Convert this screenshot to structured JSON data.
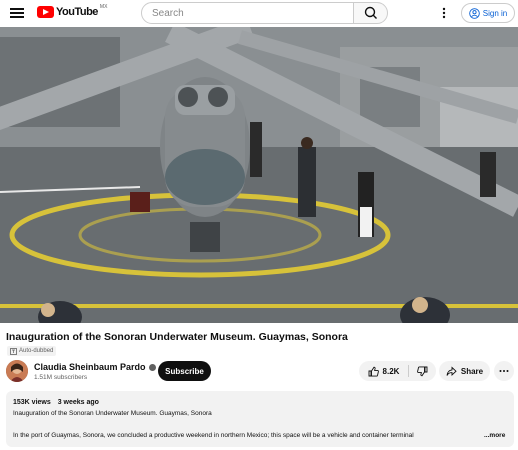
{
  "header": {
    "logo_text": "YouTube",
    "logo_region": "MX",
    "search_placeholder": "Search",
    "signin_label": "Sign in"
  },
  "video": {
    "title": "Inauguration of the Sonoran Underwater Museum. Guaymas, Sonora",
    "auto_dubbed_label": "Auto-dubbed"
  },
  "channel": {
    "name": "Claudia Sheinbaum Pardo",
    "subscribers": "1.51M subscribers",
    "subscribe_label": "Subscribe"
  },
  "actions": {
    "likes": "8.2K",
    "share_label": "Share"
  },
  "description": {
    "views": "153K views",
    "age": "3 weeks ago",
    "line1": "Inauguration of the Sonoran Underwater Museum. Guaymas, Sonora",
    "line2": "In the port of Guaymas, Sonora, we concluded a productive weekend in northern Mexico; this space will be a vehicle and container terminal",
    "more_label": "...more"
  },
  "colors": {
    "brand_red": "#ff0000",
    "link_blue": "#065fd4",
    "chip_bg": "#f2f2f2"
  }
}
